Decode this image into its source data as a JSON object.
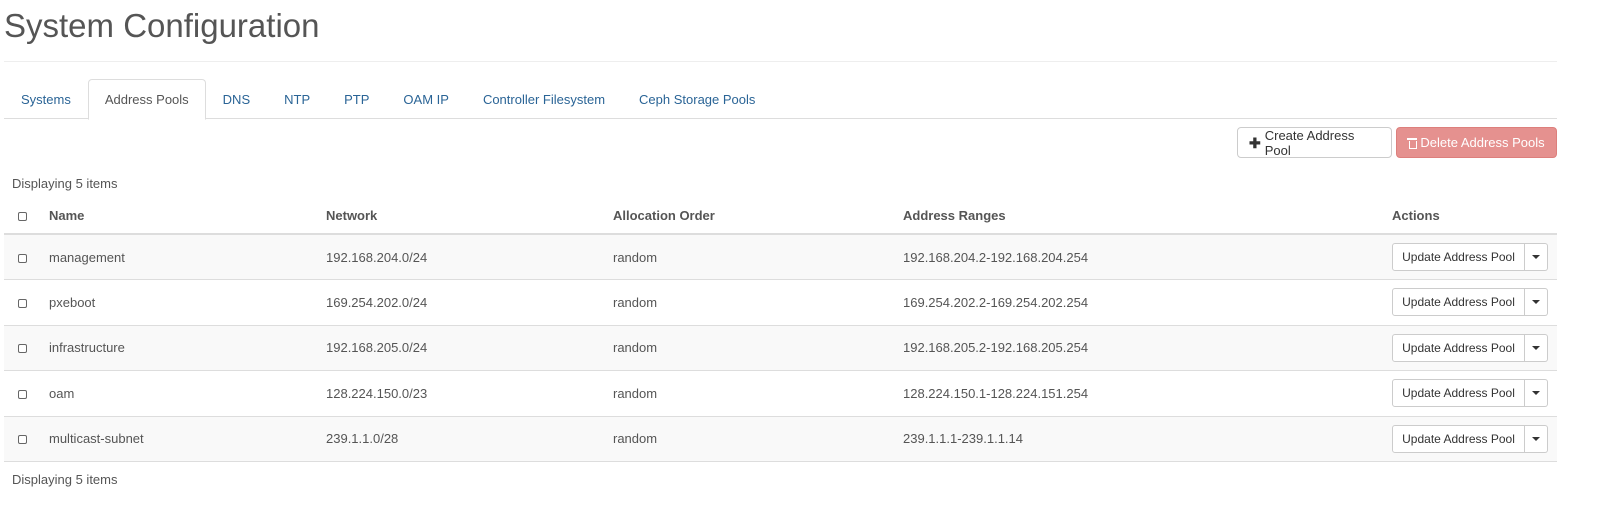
{
  "page": {
    "title": "System Configuration"
  },
  "tabs": [
    {
      "label": "Systems",
      "active": false
    },
    {
      "label": "Address Pools",
      "active": true
    },
    {
      "label": "DNS",
      "active": false
    },
    {
      "label": "NTP",
      "active": false
    },
    {
      "label": "PTP",
      "active": false
    },
    {
      "label": "OAM IP",
      "active": false
    },
    {
      "label": "Controller Filesystem",
      "active": false
    },
    {
      "label": "Ceph Storage Pools",
      "active": false
    }
  ],
  "toolbar": {
    "create_label": "Create Address Pool",
    "delete_label": "Delete Address Pools",
    "create_icon": "plus-icon",
    "delete_icon": "trash-icon",
    "delete_color": "#e5918f"
  },
  "table": {
    "count_text": "Displaying 5 items",
    "columns": [
      "Name",
      "Network",
      "Allocation Order",
      "Address Ranges",
      "Actions"
    ],
    "rows": [
      {
        "name": "management",
        "network": "192.168.204.0/24",
        "allocation": "random",
        "ranges": "192.168.204.2-192.168.204.254",
        "action": "Update Address Pool"
      },
      {
        "name": "pxeboot",
        "network": "169.254.202.0/24",
        "allocation": "random",
        "ranges": "169.254.202.2-169.254.202.254",
        "action": "Update Address Pool"
      },
      {
        "name": "infrastructure",
        "network": "192.168.205.0/24",
        "allocation": "random",
        "ranges": "192.168.205.2-192.168.205.254",
        "action": "Update Address Pool"
      },
      {
        "name": "oam",
        "network": "128.224.150.0/23",
        "allocation": "random",
        "ranges": "128.224.150.1-128.224.151.254",
        "action": "Update Address Pool"
      },
      {
        "name": "multicast-subnet",
        "network": "239.1.1.0/28",
        "allocation": "random",
        "ranges": "239.1.1.1-239.1.1.14",
        "action": "Update Address Pool"
      }
    ]
  }
}
